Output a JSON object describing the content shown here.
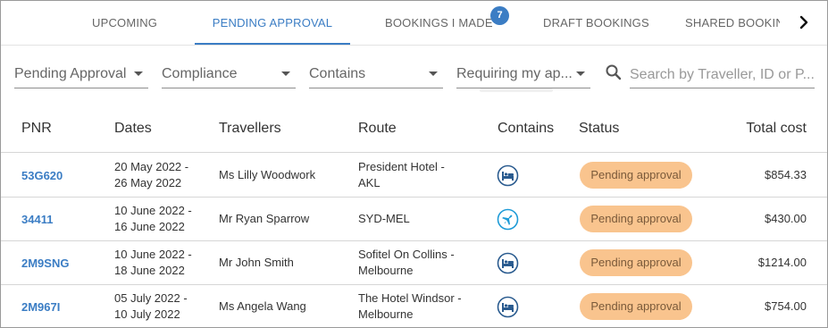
{
  "tabs": [
    {
      "label": "UPCOMING"
    },
    {
      "label": "PENDING APPROVAL"
    },
    {
      "label": "BOOKINGS I MADE",
      "badge": "7"
    },
    {
      "label": "DRAFT BOOKINGS"
    },
    {
      "label": "SHARED BOOKINGS"
    }
  ],
  "filters": {
    "status": "Pending Approval",
    "compliance": "Compliance",
    "contains": "Contains",
    "requiring": "Requiring my ap..."
  },
  "search": {
    "placeholder": "Search by Traveller, ID or P...",
    "value": ""
  },
  "table": {
    "headers": {
      "pnr": "PNR",
      "dates": "Dates",
      "travellers": "Travellers",
      "route": "Route",
      "contains": "Contains",
      "status": "Status",
      "total": "Total cost"
    },
    "rows": [
      {
        "pnr": "53G620",
        "date1": "20 May 2022 -",
        "date2": "26 May 2022",
        "traveller": "Ms Lilly Woodwork",
        "route1": "President Hotel -",
        "route2": "AKL",
        "contains": "hotel-icon",
        "status": "Pending approval",
        "total": "$854.33"
      },
      {
        "pnr": "34411",
        "date1": "10 June 2022 -",
        "date2": "16 June 2022",
        "traveller": "Mr Ryan Sparrow",
        "route1": "SYD-MEL",
        "route2": "",
        "contains": "flight-icon",
        "status": "Pending approval",
        "total": "$430.00"
      },
      {
        "pnr": "2M9SNG",
        "date1": "10 June 2022 -",
        "date2": "18 June 2022",
        "traveller": "Mr John Smith",
        "route1": "Sofitel On Collins -",
        "route2": "Melbourne",
        "contains": "hotel-icon",
        "status": "Pending approval",
        "total": "$1214.00"
      },
      {
        "pnr": "2M967I",
        "date1": "05 July 2022 -",
        "date2": "10 July 2022",
        "traveller": "Ms Angela Wang",
        "route1": "The Hotel Windsor -",
        "route2": "Melbourne",
        "contains": "hotel-icon",
        "status": "Pending approval",
        "total": "$754.00"
      }
    ]
  },
  "colors": {
    "accent": "#3b7dc4",
    "pill": "#f9c48e",
    "hotel_icon": "#2a5b8f",
    "flight_icon": "#1e9bd7"
  }
}
